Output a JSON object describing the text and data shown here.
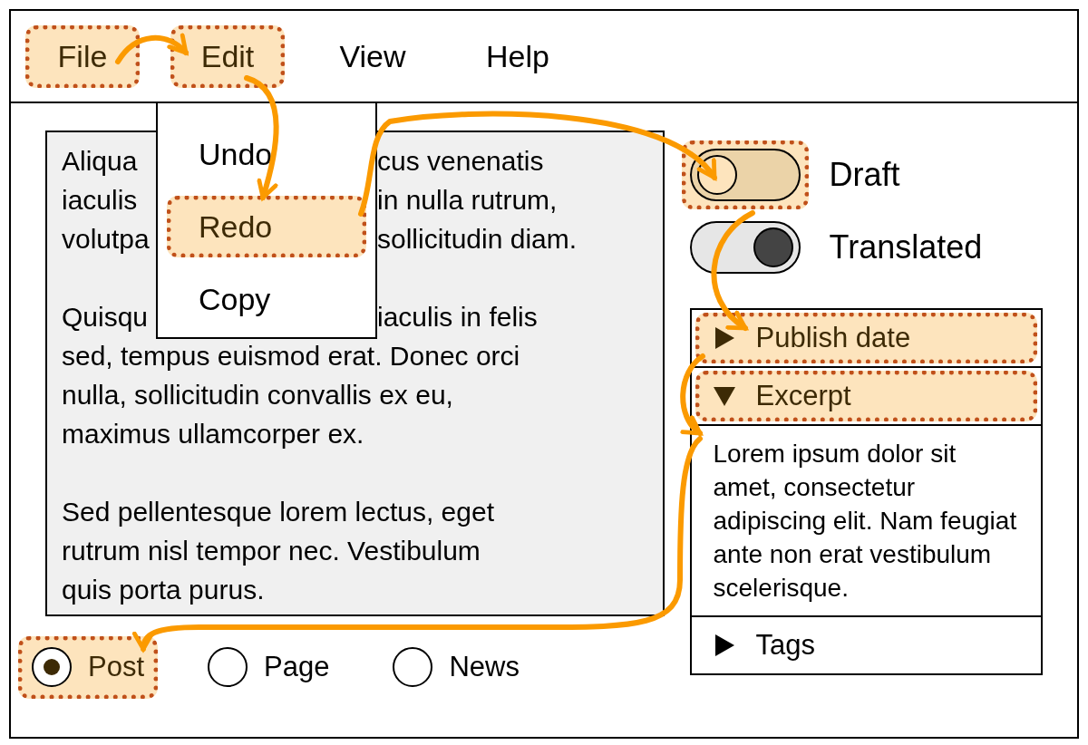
{
  "menu_bar": {
    "items": [
      {
        "label": "File",
        "highlighted": true
      },
      {
        "label": "Edit",
        "highlighted": true
      },
      {
        "label": "View",
        "highlighted": false
      },
      {
        "label": "Help",
        "highlighted": false
      }
    ]
  },
  "dropdown_menu": {
    "items": [
      {
        "label": "Undo",
        "highlighted": false
      },
      {
        "label": "Redo",
        "highlighted": true
      },
      {
        "label": "Copy",
        "highlighted": false
      }
    ]
  },
  "text_area": {
    "paragraphs": [
      [
        [
          "Aliqua",
          "cus venenatis"
        ],
        [
          "iaculis",
          "in nulla rutrum,"
        ],
        [
          "volutpa",
          "sollicitudin diam."
        ]
      ],
      [
        [
          "Quisqu",
          "iaculis in felis"
        ],
        [
          "sed, tempus euismod erat. Donec orci"
        ],
        [
          "nulla, sollicitudin convallis ex eu,"
        ],
        [
          "maximus ullamcorper ex."
        ]
      ],
      [
        [
          "Sed pellentesque lorem lectus, eget"
        ],
        [
          "rutrum nisl tempor nec. Vestibulum"
        ],
        [
          "quis porta purus."
        ]
      ]
    ]
  },
  "post_type": [
    {
      "label": "Post",
      "selected": true,
      "highlighted": true
    },
    {
      "label": "Page",
      "selected": false,
      "highlighted": false
    },
    {
      "label": "News",
      "selected": false,
      "highlighted": false
    }
  ],
  "toggles": [
    {
      "label": "Draft",
      "on": false,
      "highlighted": true
    },
    {
      "label": "Translated",
      "on": true,
      "highlighted": false
    }
  ],
  "accordion": [
    {
      "title": "Publish date",
      "expanded": false,
      "highlighted": true
    },
    {
      "title": "Excerpt",
      "expanded": true,
      "highlighted": true,
      "content": "Lorem ipsum dolor sit amet, consectetur adipiscing elit. Nam feugiat ante non erat vestibulum scelerisque."
    },
    {
      "title": "Tags",
      "expanded": false,
      "highlighted": false
    }
  ]
}
